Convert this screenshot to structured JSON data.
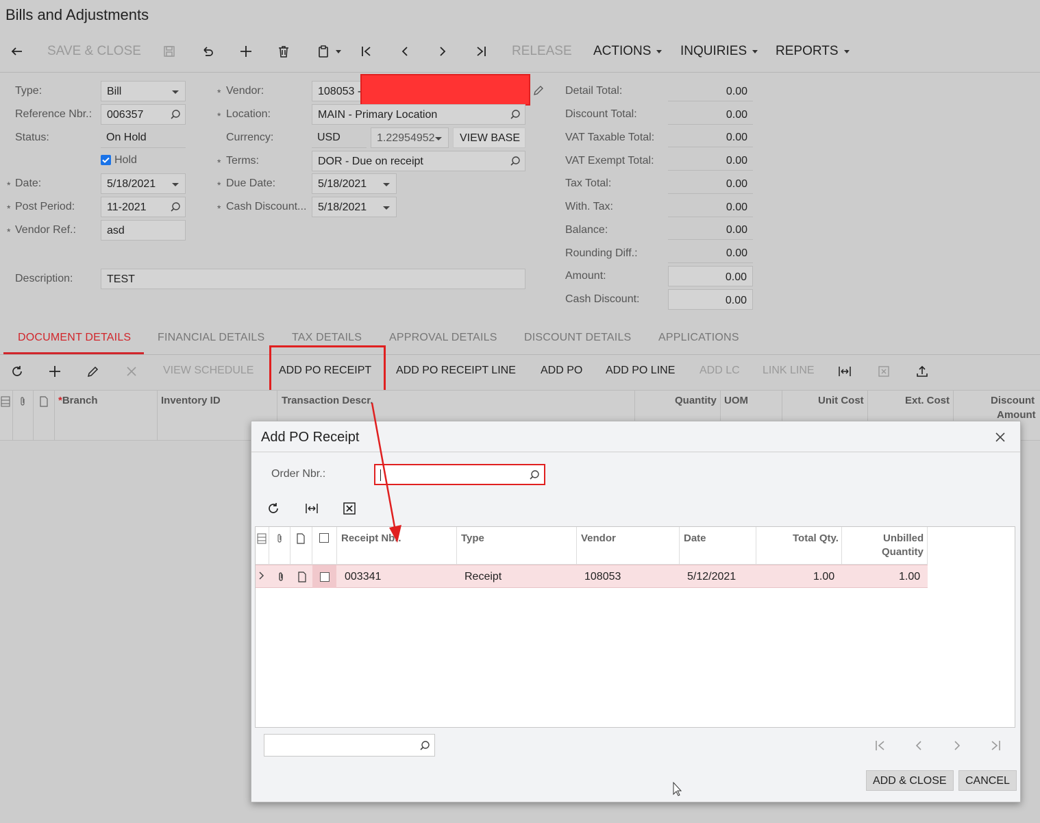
{
  "screen_title": "Bills and Adjustments",
  "toolbar": {
    "save_close": "SAVE & CLOSE",
    "release": "RELEASE",
    "actions": "ACTIONS",
    "inquiries": "INQUIRIES",
    "reports": "REPORTS"
  },
  "form": {
    "type_label": "Type:",
    "type_value": "Bill",
    "ref_label": "Reference Nbr.:",
    "ref_value": "006357",
    "status_label": "Status:",
    "status_value": "On Hold",
    "hold_label": "Hold",
    "date_label": "Date:",
    "date_value": "5/18/2021",
    "post_label": "Post Period:",
    "post_value": "11-2021",
    "vendorref_label": "Vendor Ref.:",
    "vendorref_value": "asd",
    "description_label": "Description:",
    "description_value": "TEST",
    "vendor_label": "Vendor:",
    "vendor_value": "108053 -",
    "location_label": "Location:",
    "location_value": "MAIN - Primary Location",
    "currency_label": "Currency:",
    "currency_value": "USD",
    "rate_value": "1.22954952",
    "view_base": "VIEW BASE",
    "terms_label": "Terms:",
    "terms_value": "DOR - Due on receipt",
    "due_label": "Due Date:",
    "due_value": "5/18/2021",
    "cashdisc_label": "Cash Discount...",
    "cashdisc_value": "5/18/2021"
  },
  "totals": {
    "detail_label": "Detail Total:",
    "detail": "0.00",
    "discount_label": "Discount Total:",
    "discount": "0.00",
    "vat_taxable_label": "VAT Taxable Total:",
    "vat_taxable": "0.00",
    "vat_exempt_label": "VAT Exempt Total:",
    "vat_exempt": "0.00",
    "tax_label": "Tax Total:",
    "tax": "0.00",
    "with_tax_label": "With. Tax:",
    "with_tax": "0.00",
    "balance_label": "Balance:",
    "balance": "0.00",
    "rounding_label": "Rounding Diff.:",
    "rounding": "0.00",
    "amount_label": "Amount:",
    "amount": "0.00",
    "cash_discount_label": "Cash Discount:",
    "cash_discount": "0.00"
  },
  "tabs": [
    "DOCUMENT DETAILS",
    "FINANCIAL DETAILS",
    "TAX DETAILS",
    "APPROVAL DETAILS",
    "DISCOUNT DETAILS",
    "APPLICATIONS"
  ],
  "grid_toolbar": {
    "view_schedule": "VIEW SCHEDULE",
    "add_po_receipt": "ADD PO RECEIPT",
    "add_po_receipt_line": "ADD PO RECEIPT LINE",
    "add_po": "ADD PO",
    "add_po_line": "ADD PO LINE",
    "add_lc": "ADD LC",
    "link_line": "LINK LINE"
  },
  "grid_headers": {
    "branch": "Branch",
    "inventory_id": "Inventory ID",
    "transaction_descr": "Transaction Descr.",
    "quantity": "Quantity",
    "uom": "UOM",
    "unit_cost": "Unit Cost",
    "ext_cost": "Ext. Cost",
    "discount_amount_1": "Discount",
    "discount_amount_2": "Amount"
  },
  "dialog": {
    "title": "Add PO Receipt",
    "order_label": "Order Nbr.:",
    "order_value": "",
    "headers": {
      "receipt_nbr": "Receipt Nbr.",
      "type": "Type",
      "vendor": "Vendor",
      "date": "Date",
      "total_qty": "Total Qty.",
      "unbilled_1": "Unbilled",
      "unbilled_2": "Quantity"
    },
    "rows": [
      {
        "receipt_nbr": "003341",
        "type": "Receipt",
        "vendor": "108053",
        "date": "5/12/2021",
        "total_qty": "1.00",
        "unbilled_qty": "1.00"
      }
    ],
    "add_close": "ADD & CLOSE",
    "cancel": "CANCEL"
  },
  "colors": {
    "accent": "#d1262b",
    "annotation": "#e02020",
    "selected_row": "#f9e0e2"
  }
}
